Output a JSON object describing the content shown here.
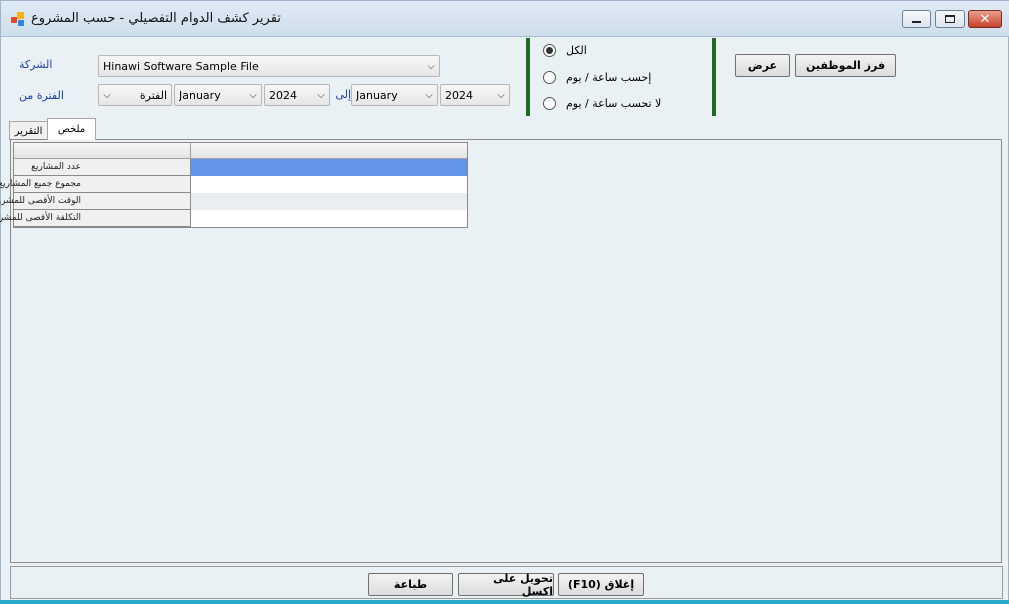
{
  "window": {
    "title": "تقرير كشف الدوام التفصيلي - حسب المشروع",
    "controls": {
      "minimize_icon": "minimize-icon",
      "maximize_icon": "maximize-icon",
      "close_label": "✕"
    }
  },
  "filters": {
    "company_label": "الشركة",
    "company_value": "Hinawi Software Sample File",
    "period_from_label": "الفترة من",
    "period_type_value": "الفترة",
    "from_month": "January",
    "from_year": "2024",
    "to_label": "إلى",
    "to_month": "January",
    "to_year": "2024"
  },
  "options": {
    "all": "الكل",
    "calc_hour_day": "إحسب ساعة / يوم",
    "no_calc_hour_day": "لا تحسب ساعة / يوم",
    "selected": "all"
  },
  "actions": {
    "show": "عرض",
    "sort_employees": "فرز الموظفين"
  },
  "tabs": [
    {
      "label": "ملخص",
      "active": true
    },
    {
      "label": "التقرير",
      "active": false
    }
  ],
  "summary_grid": {
    "rows": [
      {
        "label": "عدد المشاريع",
        "value": ""
      },
      {
        "label": "مجموع جميع المشاريع",
        "value": ""
      },
      {
        "label": "الوقت الأقصى للمشروع",
        "value": ""
      },
      {
        "label": "التكلفة الأقصى للمشروع",
        "value": ""
      }
    ]
  },
  "footer": {
    "print": "طباعة",
    "export_excel": "تحويل على اكسل",
    "close": "إغلاق (F10)"
  },
  "colors": {
    "separator": "#1f6b24",
    "selected_cell": "#6495ed",
    "label_blue": "#1c3fa8"
  }
}
